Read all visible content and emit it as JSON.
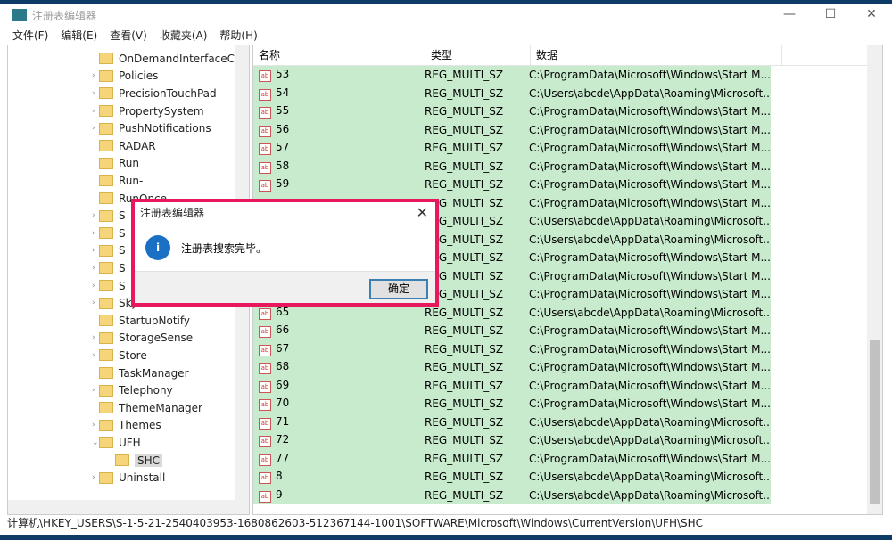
{
  "window": {
    "title": "注册表编辑器",
    "controls": [
      "—",
      "☐",
      "✕"
    ]
  },
  "menu": [
    "文件(F)",
    "编辑(E)",
    "查看(V)",
    "收藏夹(A)",
    "帮助(H)"
  ],
  "tree": [
    {
      "label": "OnDemandInterfaceC",
      "expand": ""
    },
    {
      "label": "Policies",
      "expand": "›"
    },
    {
      "label": "PrecisionTouchPad",
      "expand": "›"
    },
    {
      "label": "PropertySystem",
      "expand": "›"
    },
    {
      "label": "PushNotifications",
      "expand": "›"
    },
    {
      "label": "RADAR",
      "expand": ""
    },
    {
      "label": "Run",
      "expand": ""
    },
    {
      "label": "Run-",
      "expand": ""
    },
    {
      "label": "RunOnce",
      "expand": ""
    },
    {
      "label": "S",
      "expand": "›"
    },
    {
      "label": "S",
      "expand": "›"
    },
    {
      "label": "S",
      "expand": "›"
    },
    {
      "label": "S",
      "expand": "›"
    },
    {
      "label": "S",
      "expand": "›"
    },
    {
      "label": "Skydrive",
      "expand": "›"
    },
    {
      "label": "StartupNotify",
      "expand": ""
    },
    {
      "label": "StorageSense",
      "expand": "›"
    },
    {
      "label": "Store",
      "expand": "›"
    },
    {
      "label": "TaskManager",
      "expand": ""
    },
    {
      "label": "Telephony",
      "expand": "›"
    },
    {
      "label": "ThemeManager",
      "expand": ""
    },
    {
      "label": "Themes",
      "expand": "›"
    },
    {
      "label": "UFH",
      "expand": "⌄"
    },
    {
      "label": "SHC",
      "expand": "",
      "selected": true
    },
    {
      "label": "Uninstall",
      "expand": "›"
    }
  ],
  "list": {
    "headers": [
      "名称",
      "类型",
      "数据"
    ],
    "rows": [
      [
        "53",
        "REG_MULTI_SZ",
        "C:\\ProgramData\\Microsoft\\Windows\\Start M..."
      ],
      [
        "54",
        "REG_MULTI_SZ",
        "C:\\Users\\abcde\\AppData\\Roaming\\Microsoft..."
      ],
      [
        "55",
        "REG_MULTI_SZ",
        "C:\\ProgramData\\Microsoft\\Windows\\Start M..."
      ],
      [
        "56",
        "REG_MULTI_SZ",
        "C:\\ProgramData\\Microsoft\\Windows\\Start M..."
      ],
      [
        "57",
        "REG_MULTI_SZ",
        "C:\\ProgramData\\Microsoft\\Windows\\Start M..."
      ],
      [
        "58",
        "REG_MULTI_SZ",
        "C:\\ProgramData\\Microsoft\\Windows\\Start M..."
      ],
      [
        "59",
        "REG_MULTI_SZ",
        "C:\\ProgramData\\Microsoft\\Windows\\Start M..."
      ],
      [
        "",
        "REG_MULTI_SZ",
        "C:\\ProgramData\\Microsoft\\Windows\\Start M..."
      ],
      [
        "",
        "REG_MULTI_SZ",
        "C:\\Users\\abcde\\AppData\\Roaming\\Microsoft..."
      ],
      [
        "",
        "REG_MULTI_SZ",
        "C:\\Users\\abcde\\AppData\\Roaming\\Microsoft..."
      ],
      [
        "",
        "REG_MULTI_SZ",
        "C:\\ProgramData\\Microsoft\\Windows\\Start M..."
      ],
      [
        "",
        "REG_MULTI_SZ",
        "C:\\ProgramData\\Microsoft\\Windows\\Start M..."
      ],
      [
        "",
        "REG_MULTI_SZ",
        "C:\\ProgramData\\Microsoft\\Windows\\Start M..."
      ],
      [
        "65",
        "REG_MULTI_SZ",
        "C:\\Users\\abcde\\AppData\\Roaming\\Microsoft..."
      ],
      [
        "66",
        "REG_MULTI_SZ",
        "C:\\ProgramData\\Microsoft\\Windows\\Start M..."
      ],
      [
        "67",
        "REG_MULTI_SZ",
        "C:\\ProgramData\\Microsoft\\Windows\\Start M..."
      ],
      [
        "68",
        "REG_MULTI_SZ",
        "C:\\ProgramData\\Microsoft\\Windows\\Start M..."
      ],
      [
        "69",
        "REG_MULTI_SZ",
        "C:\\ProgramData\\Microsoft\\Windows\\Start M..."
      ],
      [
        "70",
        "REG_MULTI_SZ",
        "C:\\ProgramData\\Microsoft\\Windows\\Start M..."
      ],
      [
        "71",
        "REG_MULTI_SZ",
        "C:\\Users\\abcde\\AppData\\Roaming\\Microsoft..."
      ],
      [
        "72",
        "REG_MULTI_SZ",
        "C:\\Users\\abcde\\AppData\\Roaming\\Microsoft..."
      ],
      [
        "77",
        "REG_MULTI_SZ",
        "C:\\ProgramData\\Microsoft\\Windows\\Start M..."
      ],
      [
        "8",
        "REG_MULTI_SZ",
        "C:\\Users\\abcde\\AppData\\Roaming\\Microsoft..."
      ],
      [
        "9",
        "REG_MULTI_SZ",
        "C:\\Users\\abcde\\AppData\\Roaming\\Microsoft..."
      ]
    ]
  },
  "status": "计算机\\HKEY_USERS\\S-1-5-21-2540403953-1680862603-512367144-1001\\SOFTWARE\\Microsoft\\Windows\\CurrentVersion\\UFH\\SHC",
  "dialog": {
    "title": "注册表编辑器",
    "message": "注册表搜索完毕。",
    "ok": "确定",
    "close": "✕",
    "icon": "i"
  },
  "colors": {
    "highlight_border": "#e8185e",
    "row_bg": "#c8ebcd"
  }
}
